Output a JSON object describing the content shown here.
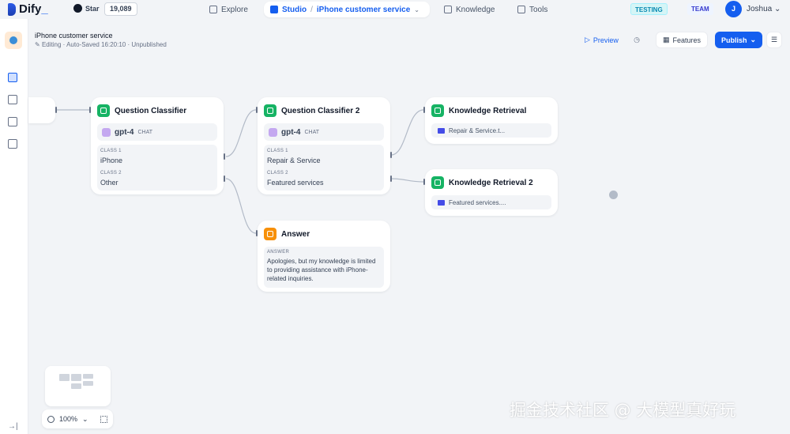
{
  "app": {
    "brand": "Dify",
    "github_label": "Star",
    "github_stars": "19,089"
  },
  "nav": {
    "explore": "Explore",
    "studio": "Studio",
    "current_app": "iPhone customer service",
    "knowledge": "Knowledge",
    "tools": "Tools"
  },
  "account": {
    "env_badge": "TESTING",
    "team_badge": "TEAM",
    "avatar_initial": "J",
    "name": "Joshua"
  },
  "workflow": {
    "title": "iPhone customer service",
    "status": "Editing · Auto-Saved 16:20:10 · Unpublished",
    "preview": "Preview",
    "features": "Features",
    "publish": "Publish"
  },
  "nodes": {
    "qc1": {
      "title": "Question Classifier",
      "model": "gpt-4",
      "model_tag": "CHAT",
      "class1_label": "CLASS 1",
      "class1": "iPhone",
      "class2_label": "CLASS 2",
      "class2": "Other"
    },
    "qc2": {
      "title": "Question Classifier 2",
      "model": "gpt-4",
      "model_tag": "CHAT",
      "class1_label": "CLASS 1",
      "class1": "Repair & Service",
      "class2_label": "CLASS 2",
      "class2": "Featured services"
    },
    "kr1": {
      "title": "Knowledge Retrieval",
      "dataset": "Repair & Service.t..."
    },
    "kr2": {
      "title": "Knowledge Retrieval 2",
      "dataset": "Featured services...."
    },
    "answer": {
      "title": "Answer",
      "label": "ANSWER",
      "text": "Apologies, but my knowledge is limited to providing assistance with iPhone-related inquiries."
    }
  },
  "canvas": {
    "zoom": "100%"
  },
  "watermark": "掘金技术社区 @ 大模型真好玩",
  "colors": {
    "accent": "#155eef",
    "node_green": "#16b364",
    "node_orange": "#f79009",
    "canvas_bg": "#f2f4f7"
  }
}
